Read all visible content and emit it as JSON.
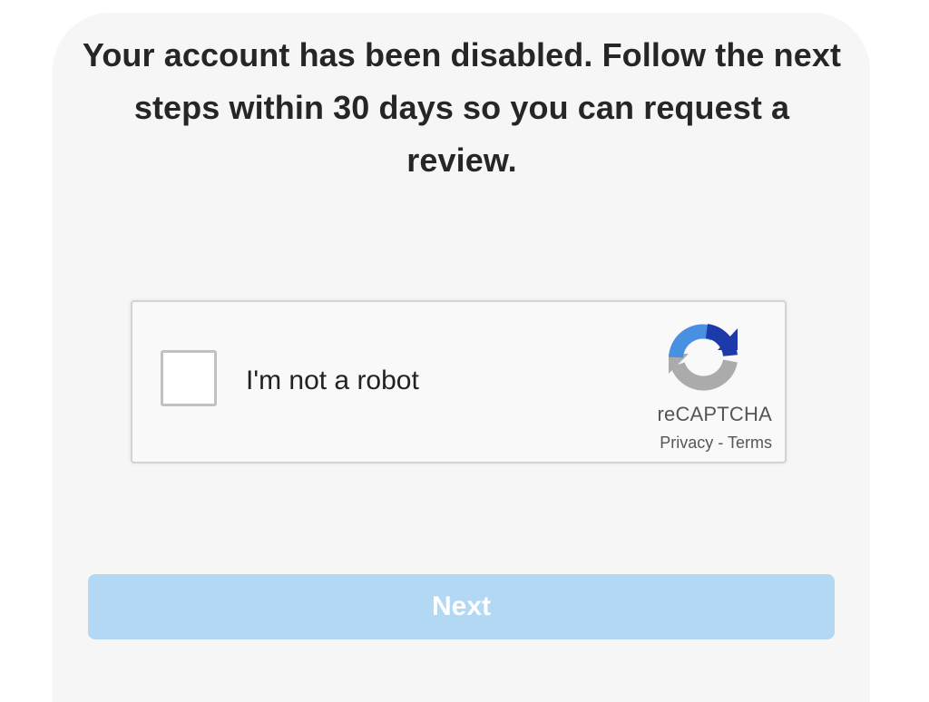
{
  "message": {
    "text": "Your account has been disabled. Follow the next steps within 30 days so you can request a review."
  },
  "captcha": {
    "checkbox_label": "I'm not a robot",
    "checked": false,
    "brand": "reCAPTCHA",
    "privacy_label": "Privacy",
    "separator": "-",
    "terms_label": "Terms",
    "logo_icon": "recaptcha-logo-icon"
  },
  "actions": {
    "next_label": "Next",
    "next_enabled": false
  },
  "colors": {
    "card_background": "#f6f6f6",
    "button_disabled": "#b2d8f4",
    "text_primary": "#262626",
    "recaptcha_blue_dark": "#1c3aa9",
    "recaptcha_blue": "#4285f4",
    "recaptcha_gray": "#ababab"
  }
}
